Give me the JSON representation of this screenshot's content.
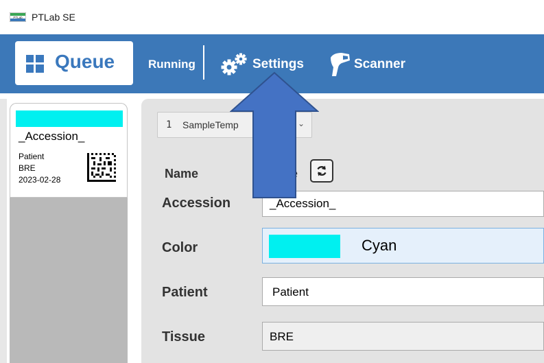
{
  "window": {
    "title": "PTLab SE",
    "logo_icon": "ptlab-logo-icon"
  },
  "toolbar": {
    "queue_label": "Queue",
    "queue_icon": "grid-icon",
    "running_label": "Running",
    "settings_label": "Settings",
    "settings_icon": "gears-icon",
    "scanner_label": "Scanner",
    "scanner_icon": "barcode-scanner-icon",
    "background_color": "#3c78b8"
  },
  "sample_card": {
    "color": "#00f0f0",
    "accession": "_Accession_",
    "patient": "Patient",
    "tissue": "BRE",
    "date": "2023-02-28"
  },
  "form": {
    "template_number": "1",
    "template_name": "SampleTemp",
    "name_label": "Name",
    "name_value": "e",
    "accession_label": "Accession",
    "accession_value": "_Accession_",
    "color_label": "Color",
    "color_value": "Cyan",
    "color_hex": "#00f0f0",
    "patient_label": "Patient",
    "patient_value": "Patient",
    "tissue_label": "Tissue",
    "tissue_value": "BRE"
  },
  "annotation": {
    "arrow_color": "#4472c4",
    "arrow_target": "Settings"
  }
}
